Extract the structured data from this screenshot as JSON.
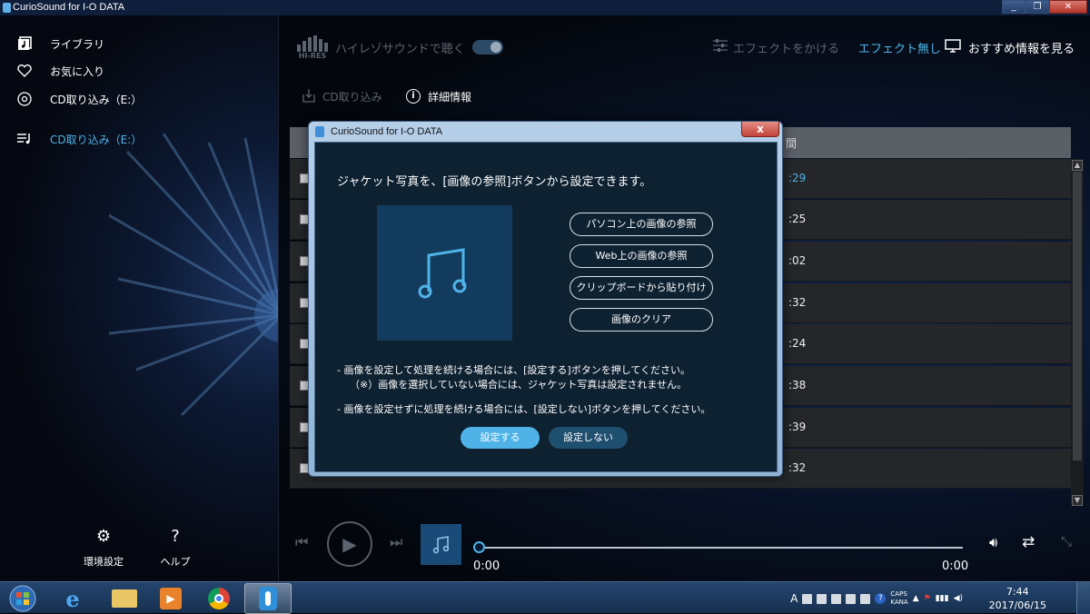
{
  "window": {
    "title": "CurioSound for I-O DATA",
    "controls": [
      "_",
      "❐",
      "✕"
    ]
  },
  "sidebar": {
    "items": [
      {
        "label": "ライブラリ",
        "icon": "library-icon"
      },
      {
        "label": "お気に入り",
        "icon": "heart-icon"
      },
      {
        "label": "CD取り込み（E:）",
        "icon": "cd-icon"
      }
    ],
    "active_item": {
      "label": "CD取り込み（E:）",
      "icon": "playlist-icon"
    },
    "bottom": [
      {
        "label": "環境設定",
        "icon": "gear-icon"
      },
      {
        "label": "ヘルプ",
        "icon": "help-icon"
      }
    ]
  },
  "topbar": {
    "hires_badge": "HI-RES",
    "hires_label": "ハイレゾサウンドで聴く",
    "effect_button": "エフェクトをかける",
    "effect_status": "エフェクト無し",
    "recommend": "おすすめ情報を見る"
  },
  "subbar": {
    "cd_import": "CD取り込み",
    "details": "詳細情報"
  },
  "table": {
    "header_partial": "間",
    "durations": [
      ":29",
      ":25",
      ":02",
      ":32",
      ":24",
      ":38",
      ":39",
      ":32"
    ]
  },
  "player": {
    "time_current": "0:00",
    "time_total": "0:00",
    "progress": 0
  },
  "dialog": {
    "title": "CurioSound for I-O DATA",
    "close": "x",
    "message": "ジャケット写真を、[画像の参照]ボタンから設定できます。",
    "buttons": [
      "パソコン上の画像の参照",
      "Web上の画像の参照",
      "クリップボードから貼り付け",
      "画像のクリア"
    ],
    "notes": [
      "- 画像を設定して処理を続ける場合には、[設定する]ボタンを押してください。",
      "（※）画像を選択していない場合には、ジャケット写真は設定されません。",
      "- 画像を設定せずに処理を続ける場合には、[設定しない]ボタンを押してください。"
    ],
    "ok": "設定する",
    "cancel": "設定しない"
  },
  "taskbar": {
    "apps": [
      "windows-start-icon",
      "ie-icon",
      "explorer-icon",
      "media-player-icon",
      "chrome-icon",
      "curiosound-icon"
    ],
    "tray": {
      "ime": "A",
      "caps": "CAPS",
      "kana": "KANA"
    },
    "time": "7:44",
    "date": "2017/06/15"
  },
  "colors": {
    "accent": "#4fb3e8",
    "dialog_bg": "#0e2131",
    "ok_button": "#4fb3e8",
    "cancel_button": "#1f4f6e"
  }
}
